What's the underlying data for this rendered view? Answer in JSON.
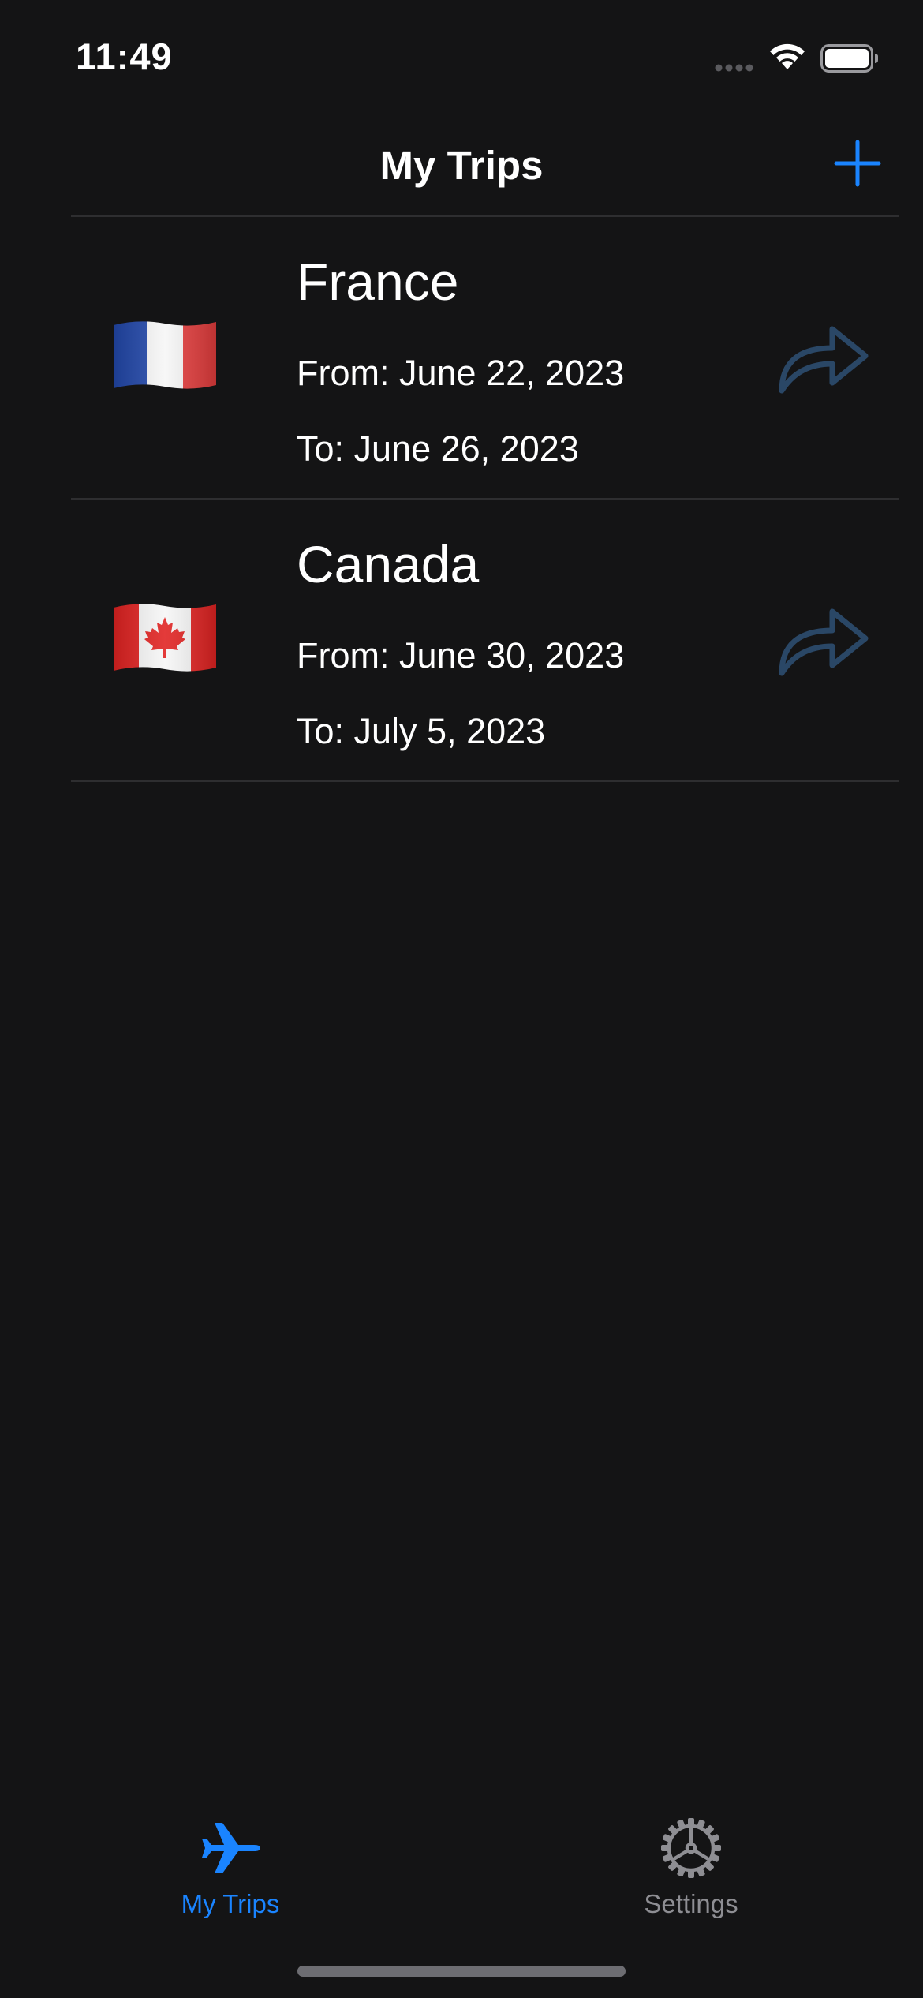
{
  "status_bar": {
    "time": "11:49"
  },
  "nav": {
    "title": "My Trips",
    "add_icon": "plus-icon"
  },
  "colors": {
    "accent": "#1a84ff",
    "background": "#141415",
    "share_icon": "#2a4766",
    "inactive_tab": "#8e8e93"
  },
  "trips": [
    {
      "country": "France",
      "flag": "france-flag",
      "from": "From: June 22, 2023",
      "to": "To: June 26, 2023",
      "share_icon": "share-arrow-icon"
    },
    {
      "country": "Canada",
      "flag": "canada-flag",
      "from": "From: June 30, 2023",
      "to": "To: July 5, 2023",
      "share_icon": "share-arrow-icon"
    }
  ],
  "tabs": [
    {
      "label": "My Trips",
      "icon": "airplane-icon",
      "selected": true
    },
    {
      "label": "Settings",
      "icon": "gear-icon",
      "selected": false
    }
  ]
}
